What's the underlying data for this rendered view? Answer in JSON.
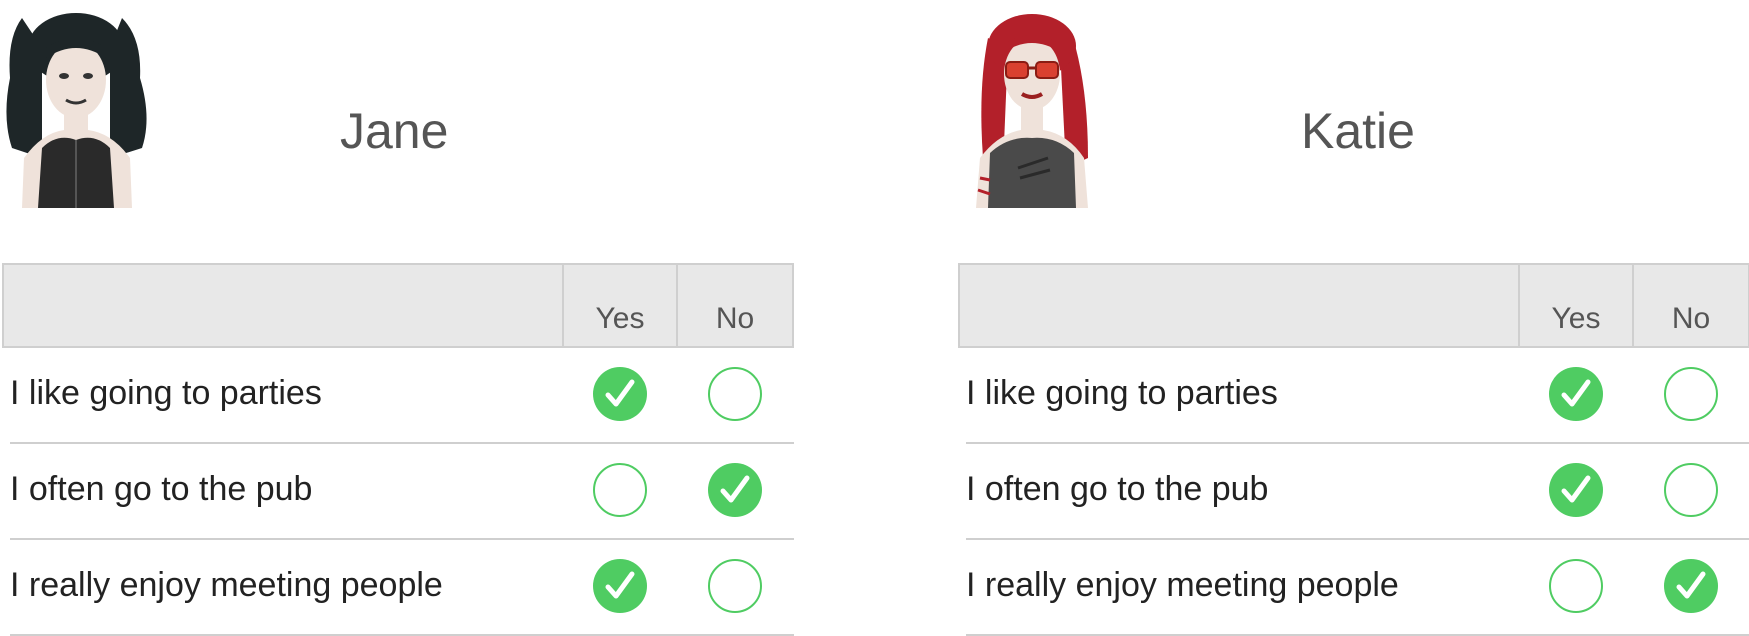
{
  "columns": {
    "yes": "Yes",
    "no": "No"
  },
  "accent_color": "#4fcc62",
  "people": [
    {
      "name": "Jane",
      "avatar_icon": "goth-woman-avatar-icon",
      "rows": [
        {
          "statement": "I like going to parties",
          "answer": "yes"
        },
        {
          "statement": "I often go to the pub",
          "answer": "no"
        },
        {
          "statement": "I really enjoy meeting people",
          "answer": "yes"
        }
      ]
    },
    {
      "name": "Katie",
      "avatar_icon": "redhead-woman-avatar-icon",
      "rows": [
        {
          "statement": "I like going to parties",
          "answer": "yes"
        },
        {
          "statement": "I often go to the pub",
          "answer": "yes"
        },
        {
          "statement": "I really enjoy meeting people",
          "answer": "no"
        }
      ]
    }
  ]
}
